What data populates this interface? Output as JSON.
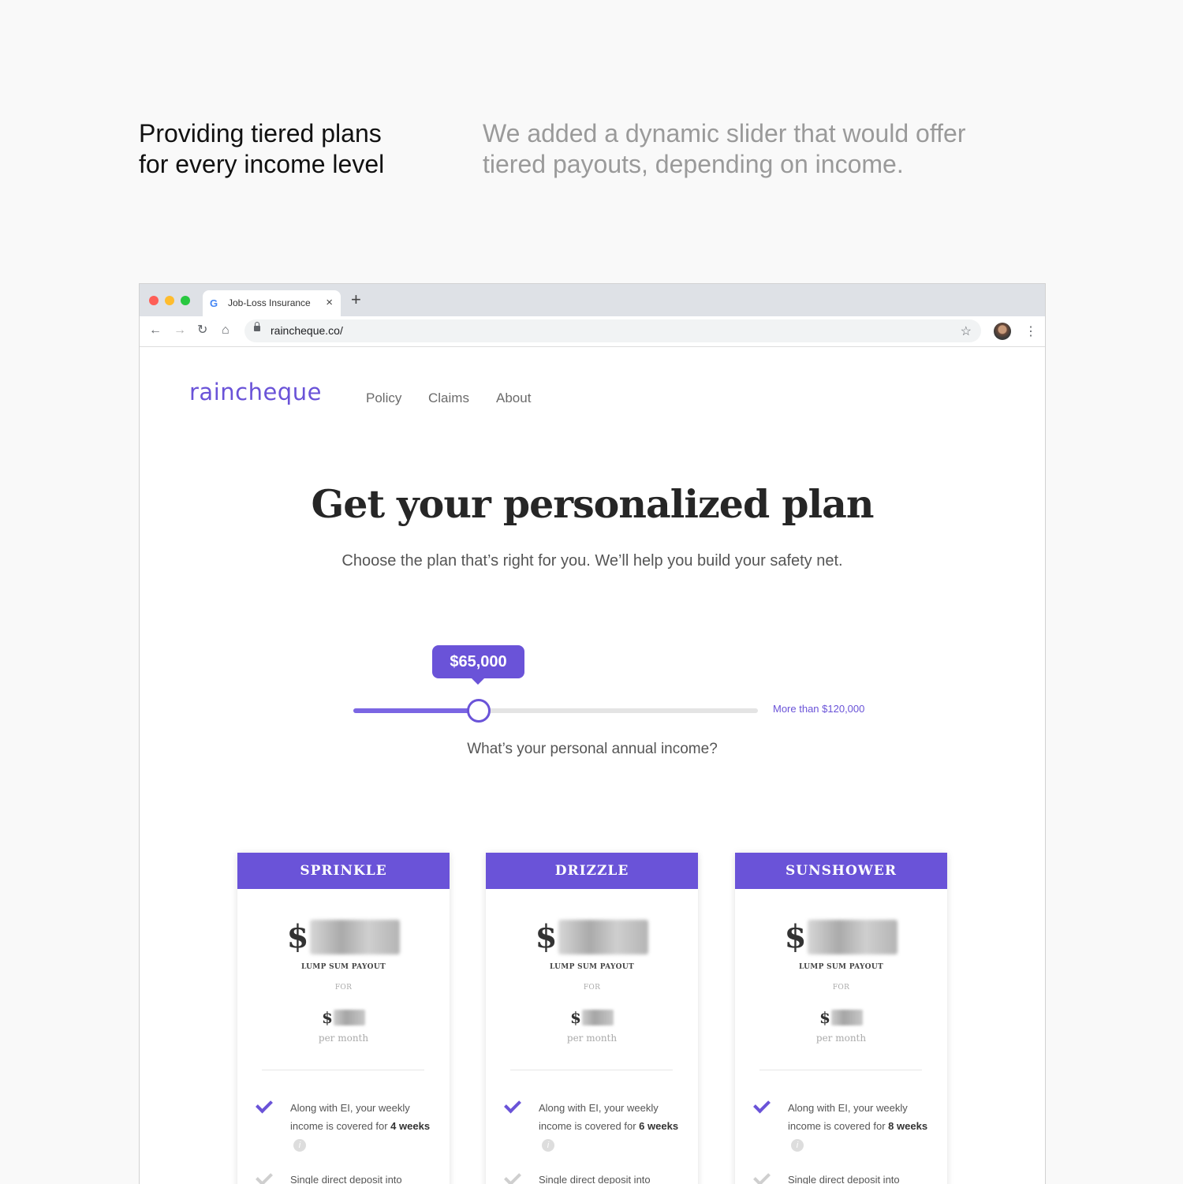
{
  "caption": {
    "title_lines": [
      "Providing tiered plans",
      "for every income level"
    ],
    "description_lines": [
      "We added a dynamic slider that would offer",
      "tiered payouts, depending on income."
    ]
  },
  "browser": {
    "tab_title": "Job-Loss Insurance",
    "tab_close": "×",
    "new_tab": "+",
    "url": "raincheque.co/",
    "icons": {
      "back": "back-arrow-icon",
      "forward": "forward-arrow-icon",
      "reload": "reload-icon",
      "home": "home-icon",
      "bookmark": "star-icon",
      "menu": "kebab-menu-icon"
    },
    "back_glyph": "←",
    "forward_glyph": "→",
    "reload_glyph": "↻",
    "home_glyph": "⌂",
    "star_glyph": "☆",
    "kebab_glyph": "⋮",
    "google_glyph": "G"
  },
  "site": {
    "logo": "raincheque",
    "nav": [
      "Policy",
      "Claims",
      "About"
    ],
    "headline": "Get your personalized plan",
    "subhead": "Choose the plan that’s right for you. We’ll help you build your safety net.",
    "slider": {
      "value_label": "$65,000",
      "max_label": "More than $120,000",
      "question": "What’s your personal annual income?",
      "fraction": 0.31
    },
    "plans": [
      {
        "name": "SPRINKLE",
        "currency": "$",
        "lump_label": "LUMP SUM PAYOUT",
        "for_label": "FOR",
        "per_month": "per month",
        "feature1_prefix": "Along with EI, your weekly income is covered for ",
        "feature1_bold": "4 weeks",
        "feature2": "Single direct deposit into"
      },
      {
        "name": "DRIZZLE",
        "currency": "$",
        "lump_label": "LUMP SUM PAYOUT",
        "for_label": "FOR",
        "per_month": "per month",
        "feature1_prefix": "Along with EI, your weekly income is covered for ",
        "feature1_bold": "6 weeks",
        "feature2": "Single direct deposit into"
      },
      {
        "name": "SUNSHOWER",
        "currency": "$",
        "lump_label": "LUMP SUM PAYOUT",
        "for_label": "FOR",
        "per_month": "per month",
        "feature1_prefix": "Along with EI, your weekly income is covered for ",
        "feature1_bold": "8 weeks",
        "feature2": "Single direct deposit into"
      }
    ],
    "info_glyph": "i"
  },
  "colors": {
    "brand": "#6a53d8",
    "background": "#f9f9f9"
  }
}
